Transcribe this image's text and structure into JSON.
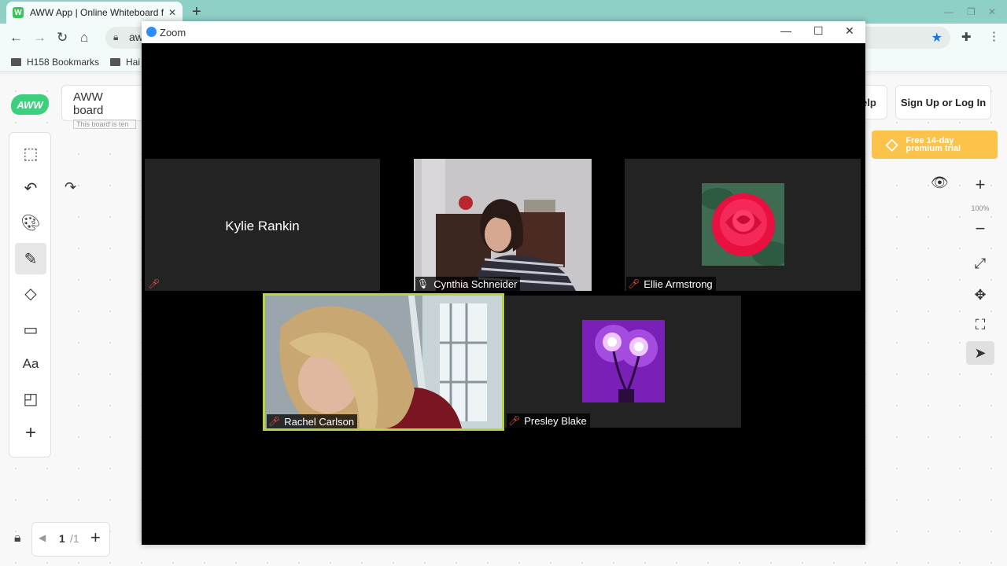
{
  "browser": {
    "tab_title": "AWW App | Online Whiteboard f...",
    "tab_favicon": "W",
    "url": "aw",
    "bookmarks": [
      "H158 Bookmarks",
      "Hai"
    ]
  },
  "aww": {
    "logo": "AWW",
    "board_name": "AWW board",
    "board_sub": "This board is ten",
    "help_label": "elp",
    "signup_label": "Sign Up or Log In",
    "premium_line1": "Free 14-day",
    "premium_line2": "premium trial",
    "zoom_level": "100%",
    "page_current": "1",
    "page_total": "/1",
    "left_tools": [
      "select-tool",
      "undo",
      "palette",
      "pen",
      "eraser",
      "rectangle",
      "text",
      "sticky-note",
      "add"
    ],
    "text_tool_label": "Aa"
  },
  "zoom": {
    "window_title": "Zoom",
    "participants": [
      {
        "name": "Kylie Rankin",
        "muted": true,
        "video": false
      },
      {
        "name": "Cynthia Schneider",
        "muted": false,
        "video": true
      },
      {
        "name": "Ellie Armstrong",
        "muted": true,
        "video": false,
        "avatar": "red rose"
      },
      {
        "name": "Rachel Carlson",
        "muted": true,
        "video": true,
        "active_speaker": true
      },
      {
        "name": "Presley Blake",
        "muted": true,
        "video": false,
        "avatar": "purple glowing roses"
      }
    ]
  },
  "colors": {
    "tabbar": "#8ecfc6",
    "aww_green": "#3ccf7e",
    "premium": "#fbc34a",
    "active_speaker": "#b4d63c",
    "mute_red": "#e54"
  }
}
